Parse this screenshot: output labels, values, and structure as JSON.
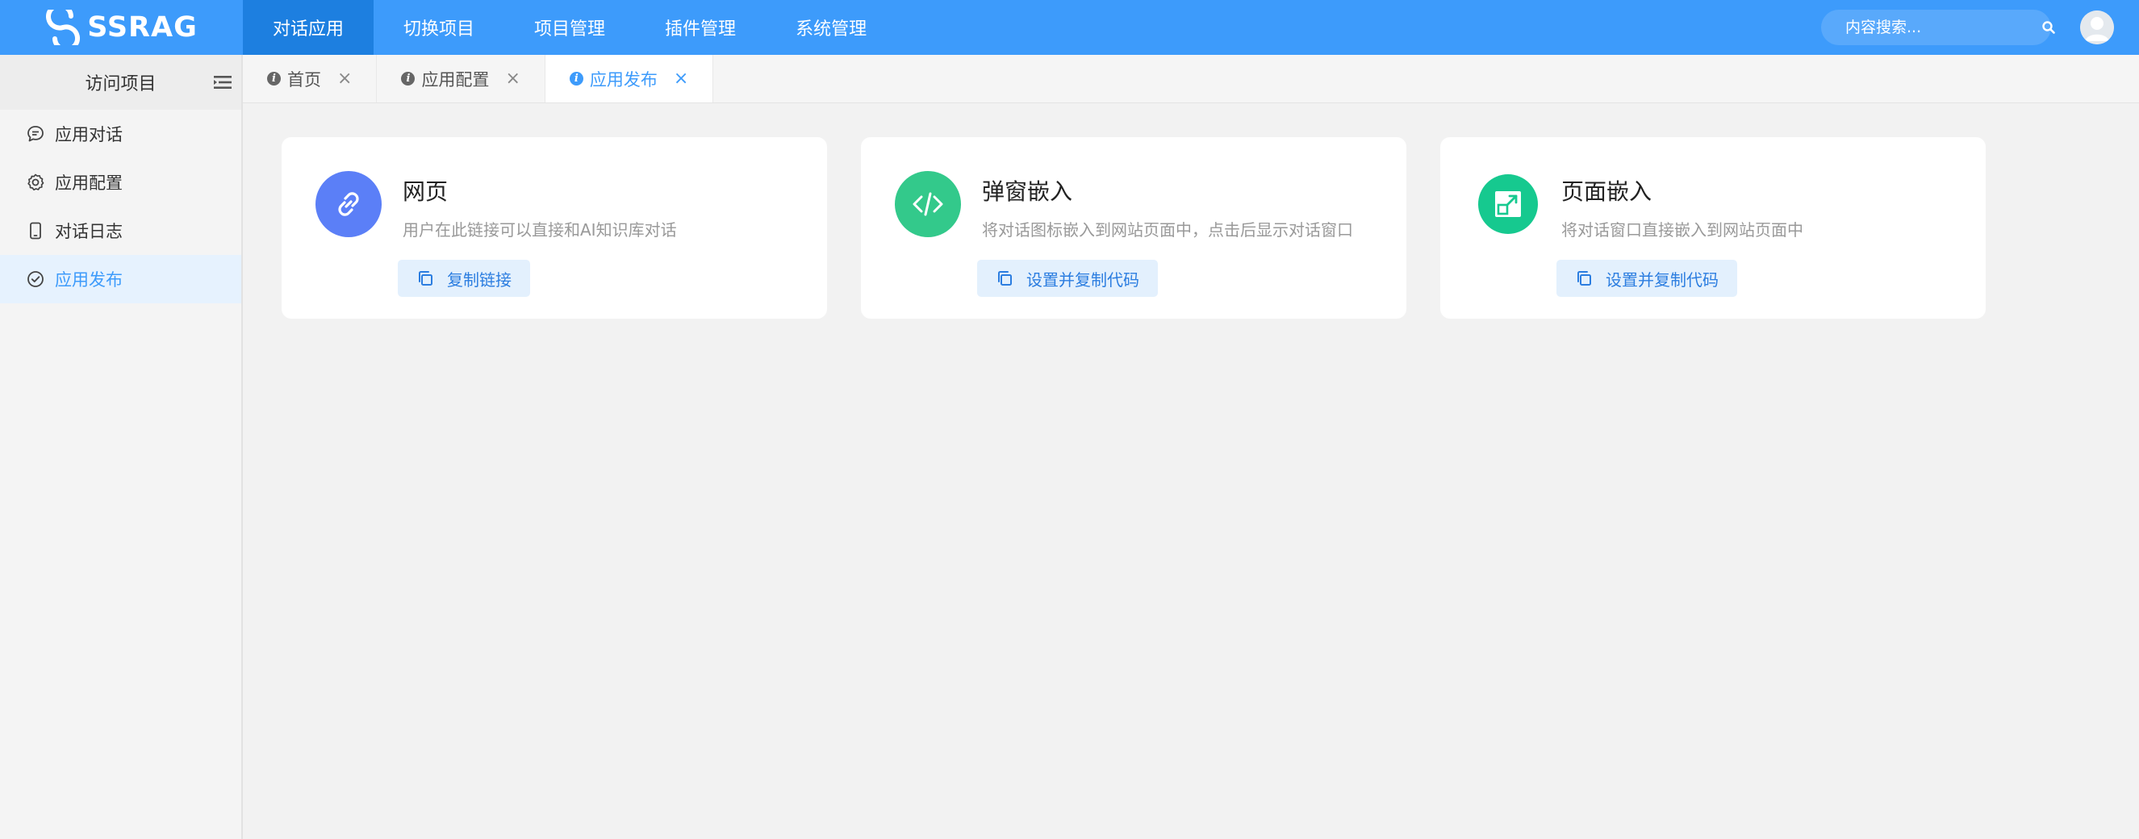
{
  "brand": {
    "name": "SSRAG"
  },
  "topnav": {
    "items": [
      {
        "label": "对话应用",
        "active": true
      },
      {
        "label": "切换项目",
        "active": false
      },
      {
        "label": "项目管理",
        "active": false
      },
      {
        "label": "插件管理",
        "active": false
      },
      {
        "label": "系统管理",
        "active": false
      }
    ]
  },
  "search": {
    "placeholder": "内容搜索..."
  },
  "sidebar": {
    "title": "访问项目",
    "items": [
      {
        "label": "应用对话",
        "icon": "chat-icon",
        "active": false
      },
      {
        "label": "应用配置",
        "icon": "gear-icon",
        "active": false
      },
      {
        "label": "对话日志",
        "icon": "phone-icon",
        "active": false
      },
      {
        "label": "应用发布",
        "icon": "check-circle-icon",
        "active": true
      }
    ]
  },
  "tabs": [
    {
      "label": "首页",
      "active": false
    },
    {
      "label": "应用配置",
      "active": false
    },
    {
      "label": "应用发布",
      "active": true
    }
  ],
  "cards": [
    {
      "title": "网页",
      "description": "用户在此链接可以直接和AI知识库对话",
      "button": "复制链接",
      "icon": "link-icon",
      "color": "#5b7ff7"
    },
    {
      "title": "弹窗嵌入",
      "description": "将对话图标嵌入到网站页面中，点击后显示对话窗口",
      "button": "设置并复制代码",
      "icon": "code-icon",
      "color": "#33c98b"
    },
    {
      "title": "页面嵌入",
      "description": "将对话窗口直接嵌入到网站页面中",
      "button": "设置并复制代码",
      "icon": "embed-icon",
      "color": "#16c98f"
    }
  ],
  "colors": {
    "accent": "#3d9bfb",
    "nav_active": "#1d7fe0",
    "page_bg": "#f2f2f2"
  }
}
